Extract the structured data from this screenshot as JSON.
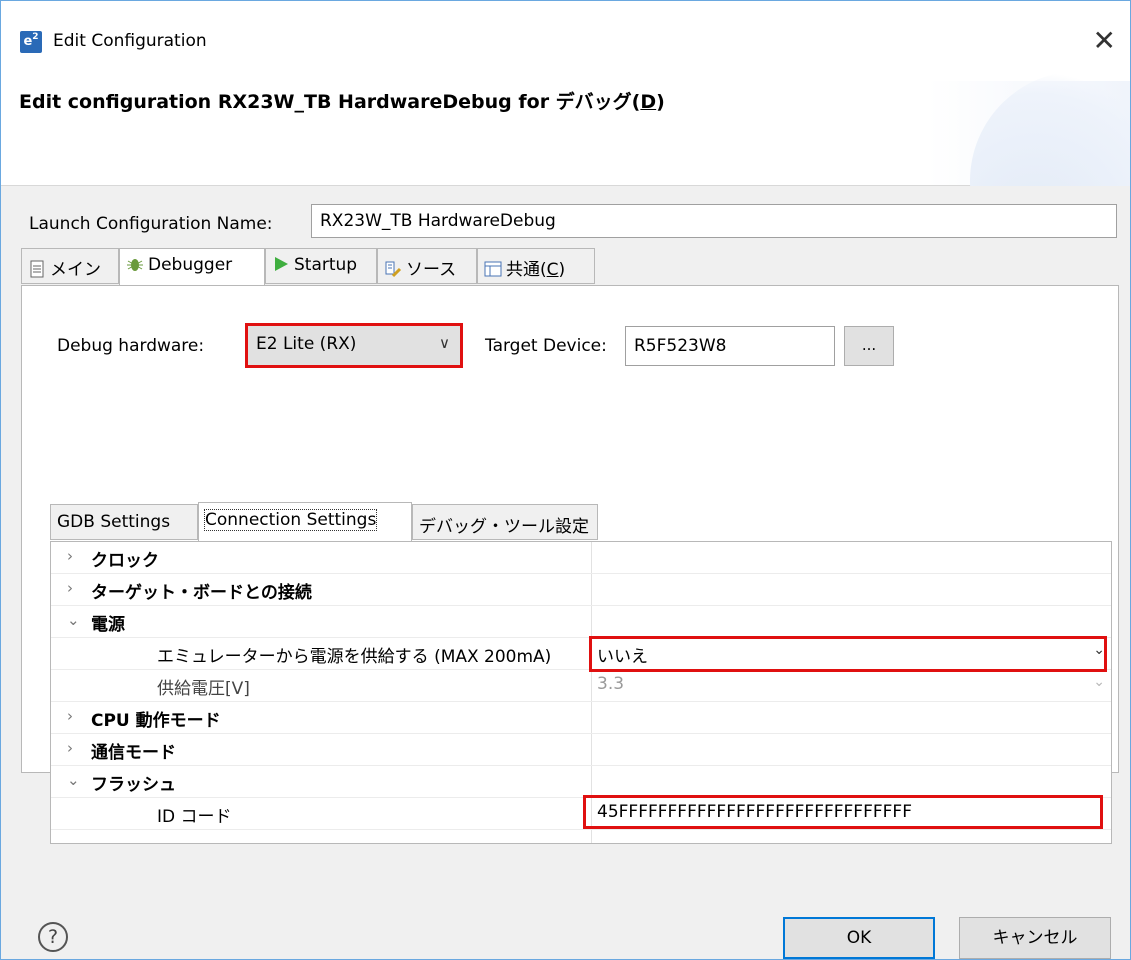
{
  "window": {
    "title": "Edit Configuration",
    "app_icon": "e²"
  },
  "banner": {
    "title_prefix": "Edit configuration RX23W_TB HardwareDebug for デバッグ(",
    "title_key": "D",
    "title_suffix": ")"
  },
  "launch_config": {
    "label": "Launch Configuration Name:",
    "value": "RX23W_TB HardwareDebug"
  },
  "tabs": [
    {
      "label": "メイン",
      "icon": "document-icon"
    },
    {
      "label": "Debugger",
      "icon": "bug-icon"
    },
    {
      "label": "Startup",
      "icon": "play-icon"
    },
    {
      "label": "ソース",
      "icon": "source-icon"
    },
    {
      "label": "共通(",
      "key": "C",
      "suffix": ")",
      "icon": "table-icon"
    }
  ],
  "debugger": {
    "hardware_label": "Debug hardware:",
    "hardware_value": "E2 Lite (RX)",
    "target_label": "Target Device:",
    "target_value": "R5F523W8",
    "browse_label": "..."
  },
  "subtabs": [
    "GDB Settings",
    "Connection Settings",
    "デバッグ・ツール設定"
  ],
  "settings_rows": [
    {
      "label": "クロック",
      "expanded": false,
      "value": ""
    },
    {
      "label": "ターゲット・ボードとの接続",
      "expanded": false,
      "value": ""
    },
    {
      "label": "電源",
      "expanded": true,
      "value": ""
    },
    {
      "label": "エミュレーターから電源を供給する (MAX 200mA)",
      "value": "いいえ"
    },
    {
      "label": "供給電圧[V]",
      "value": "3.3"
    },
    {
      "label": "CPU 動作モード",
      "expanded": false,
      "value": ""
    },
    {
      "label": "通信モード",
      "expanded": false,
      "value": ""
    },
    {
      "label": "フラッシュ",
      "expanded": true,
      "value": ""
    },
    {
      "label": "ID コード",
      "value": "45FFFFFFFFFFFFFFFFFFFFFFFFFFFFFF"
    }
  ],
  "footer": {
    "help": "?",
    "ok_label": "OK",
    "cancel_label": "キャンセル"
  },
  "colors": {
    "highlight": "#e01010",
    "accent": "#0078d7",
    "panel_bg": "#f0f0f0"
  }
}
